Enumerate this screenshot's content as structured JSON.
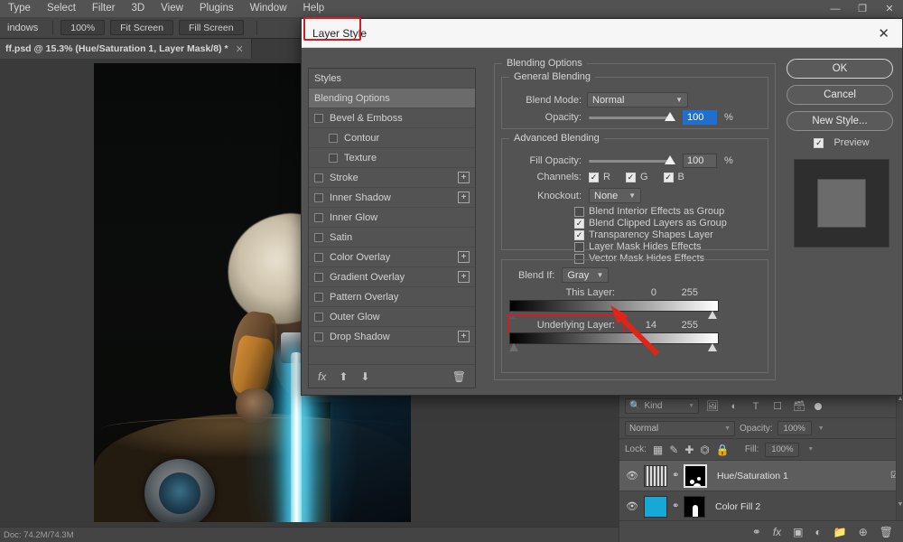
{
  "app": {
    "menu_items": [
      "Type",
      "Select",
      "Filter",
      "3D",
      "View",
      "Plugins",
      "Window",
      "Help"
    ],
    "window_controls": {
      "minimize": "—",
      "restore": "❐",
      "close": "✕"
    }
  },
  "options_bar": {
    "left_label": "indows",
    "buttons": [
      "100%",
      "Fit Screen",
      "Fill Screen"
    ]
  },
  "document_tab": {
    "title": "ff.psd @ 15.3% (Hue/Saturation 1, Layer Mask/8) *",
    "close": "✕"
  },
  "status_bar": {
    "text": "Doc: 74.2M/74.3M"
  },
  "dialog": {
    "title": "Layer Style",
    "close": "✕",
    "styles_panel": {
      "header": "Styles",
      "active": "Blending Options",
      "items": [
        {
          "label": "Bevel & Emboss",
          "checked": false,
          "indent": false,
          "plus": false
        },
        {
          "label": "Contour",
          "checked": false,
          "indent": true,
          "plus": false
        },
        {
          "label": "Texture",
          "checked": false,
          "indent": true,
          "plus": false
        },
        {
          "label": "Stroke",
          "checked": false,
          "indent": false,
          "plus": true
        },
        {
          "label": "Inner Shadow",
          "checked": false,
          "indent": false,
          "plus": true
        },
        {
          "label": "Inner Glow",
          "checked": false,
          "indent": false,
          "plus": false
        },
        {
          "label": "Satin",
          "checked": false,
          "indent": false,
          "plus": false
        },
        {
          "label": "Color Overlay",
          "checked": false,
          "indent": false,
          "plus": true
        },
        {
          "label": "Gradient Overlay",
          "checked": false,
          "indent": false,
          "plus": true
        },
        {
          "label": "Pattern Overlay",
          "checked": false,
          "indent": false,
          "plus": false
        },
        {
          "label": "Outer Glow",
          "checked": false,
          "indent": false,
          "plus": false
        },
        {
          "label": "Drop Shadow",
          "checked": false,
          "indent": false,
          "plus": true
        }
      ],
      "footer_icons": [
        "fx-icon",
        "move-up-icon",
        "move-down-icon",
        "trash-icon"
      ]
    },
    "blending": {
      "section_title": "Blending Options",
      "general": {
        "legend": "General Blending",
        "blend_mode_label": "Blend Mode:",
        "blend_mode_value": "Normal",
        "opacity_label": "Opacity:",
        "opacity_value": "100",
        "opacity_unit": "%"
      },
      "advanced": {
        "legend": "Advanced Blending",
        "fill_opacity_label": "Fill Opacity:",
        "fill_opacity_value": "100",
        "fill_opacity_unit": "%",
        "channels_label": "Channels:",
        "channels": [
          {
            "label": "R",
            "checked": true
          },
          {
            "label": "G",
            "checked": true
          },
          {
            "label": "B",
            "checked": true
          }
        ],
        "knockout_label": "Knockout:",
        "knockout_value": "None",
        "checkboxes": [
          {
            "label": "Blend Interior Effects as Group",
            "checked": false
          },
          {
            "label": "Blend Clipped Layers as Group",
            "checked": true
          },
          {
            "label": "Transparency Shapes Layer",
            "checked": true
          },
          {
            "label": "Layer Mask Hides Effects",
            "checked": false
          },
          {
            "label": "Vector Mask Hides Effects",
            "checked": false
          }
        ]
      },
      "blend_if": {
        "label": "Blend If:",
        "channel_value": "Gray",
        "this_layer_label": "This Layer:",
        "this_layer_min": "0",
        "this_layer_max": "255",
        "underlying_label": "Underlying Layer:",
        "underlying_min": "14",
        "underlying_max": "255"
      }
    },
    "buttons": {
      "ok": "OK",
      "cancel": "Cancel",
      "new_style": "New Style...",
      "preview_label": "Preview",
      "preview_checked": true
    }
  },
  "layers_panel": {
    "filter": {
      "kind_label": "Kind",
      "search_icon": "search-icon",
      "filter_icons": [
        "image-filter-icon",
        "adjustment-filter-icon",
        "type-filter-icon",
        "shape-filter-icon",
        "smart-object-filter-icon"
      ]
    },
    "blend_mode": "Normal",
    "opacity_label": "Opacity:",
    "opacity_value": "100%",
    "lock_label": "Lock:",
    "lock_icons": [
      "lock-transparent-icon",
      "lock-image-icon",
      "lock-position-icon",
      "lock-artboard-icon",
      "lock-all-icon"
    ],
    "fill_label": "Fill:",
    "fill_value": "100%",
    "layers": [
      {
        "name": "Hue/Saturation 1",
        "selected": true,
        "visible": true,
        "thumb": "adjustment",
        "has_mask": true,
        "fx_badge": true
      },
      {
        "name": "Color Fill 2",
        "selected": false,
        "visible": true,
        "thumb": "color",
        "thumb_color": "#17a8d6",
        "has_mask": true,
        "fx_badge": false
      }
    ],
    "bottom_icons": [
      "link-icon",
      "fx-icon",
      "mask-icon",
      "adjustment-icon",
      "group-icon",
      "new-layer-icon",
      "trash-icon"
    ]
  },
  "annotations": {
    "highlight_color": "#cc2026",
    "highlighted_regions": [
      "Layer Style",
      "Underlying Layer:"
    ],
    "arrow_target": "underlying-layer-value"
  }
}
